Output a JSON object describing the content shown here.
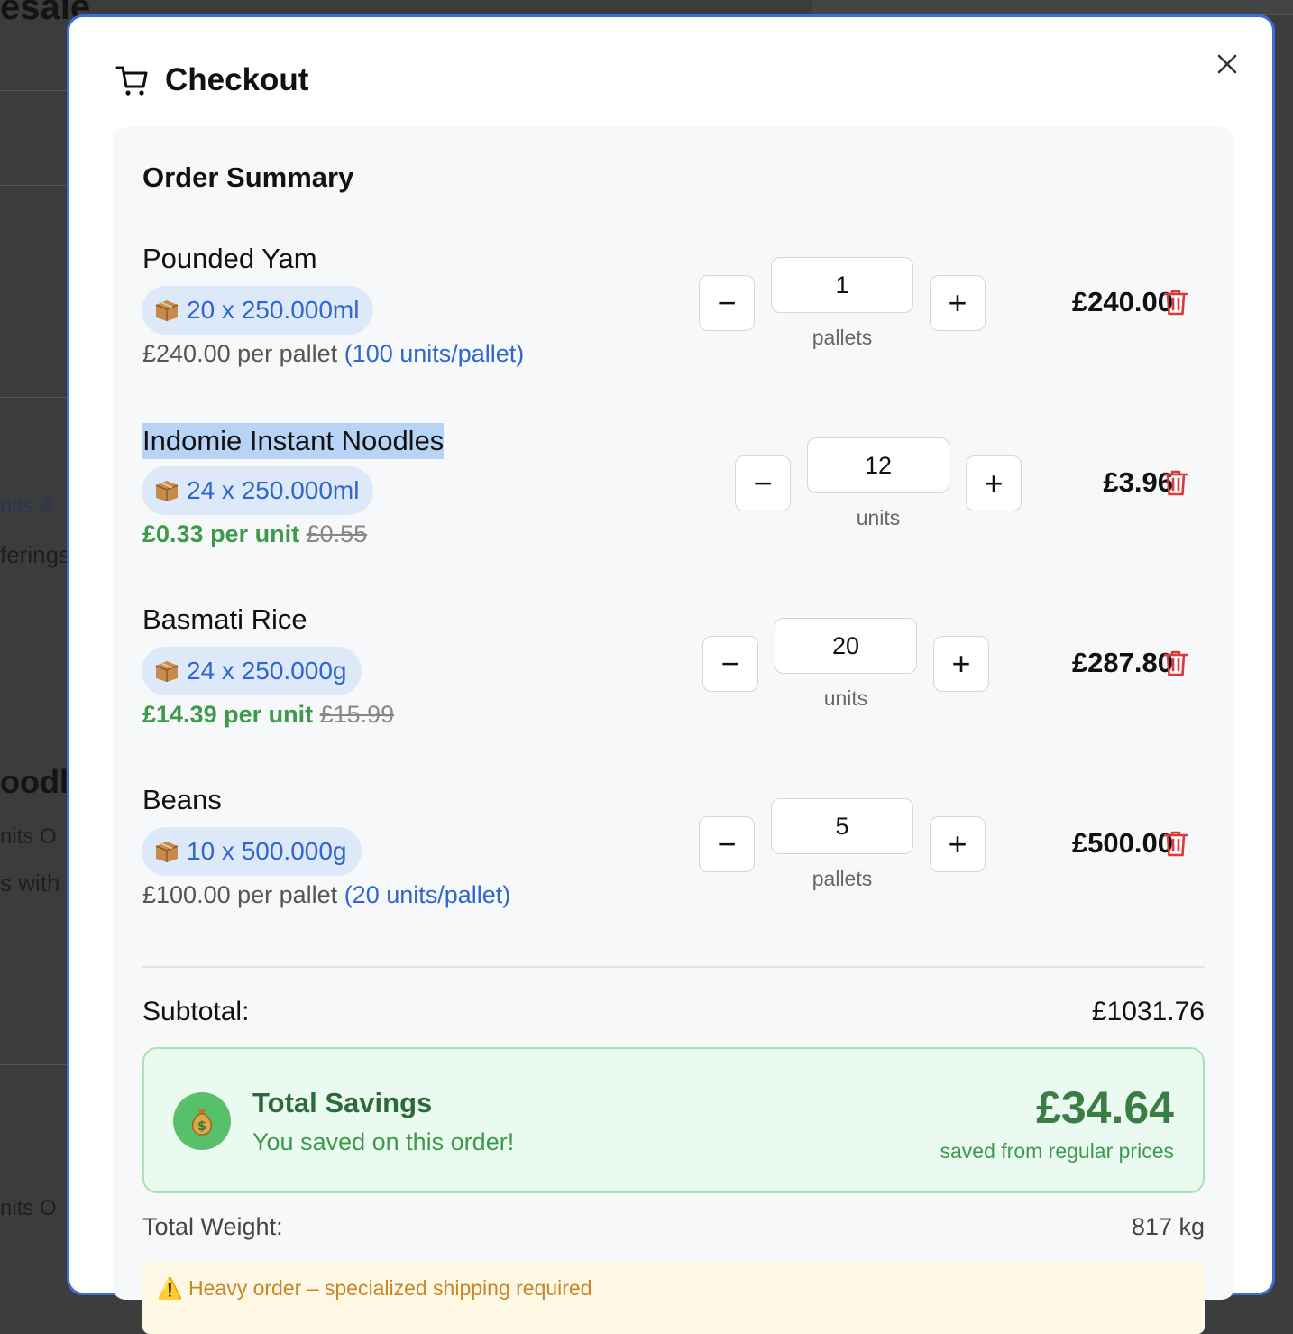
{
  "background": {
    "fragments": [
      "esale",
      "nits &",
      "ferings",
      "oodle",
      "nits O",
      "s with",
      "nits O"
    ]
  },
  "modal": {
    "title": "Checkout",
    "icons": {
      "cart": "cart-icon",
      "close": "close-icon"
    }
  },
  "summary": {
    "title": "Order Summary",
    "items": [
      {
        "name": "Pounded Yam",
        "pack": "20 x 250.000ml",
        "price_main": "£240.00 per pallet",
        "price_extra": "(100 units/pallet)",
        "quantity": "1",
        "unit": "pallets",
        "total": "£240.00"
      },
      {
        "name": "Indomie Instant Noodles",
        "pack": "24 x 250.000ml",
        "price_main": "£0.33 per unit",
        "price_extra": "£0.55",
        "quantity": "12",
        "unit": "units",
        "total": "£3.96"
      },
      {
        "name": "Basmati Rice",
        "pack": "24 x 250.000g",
        "price_main": "£14.39 per unit",
        "price_extra": "£15.99",
        "quantity": "20",
        "unit": "units",
        "total": "£287.80"
      },
      {
        "name": "Beans",
        "pack": "10 x 500.000g",
        "price_main": "£100.00 per pallet",
        "price_extra": "(20 units/pallet)",
        "quantity": "5",
        "unit": "pallets",
        "total": "£500.00"
      }
    ],
    "stepper": {
      "minus": "−",
      "plus": "+"
    },
    "subtotal_label": "Subtotal:",
    "subtotal_value": "£1031.76",
    "savings": {
      "title": "Total Savings",
      "subtitle": "You saved on this order!",
      "amount": "£34.64",
      "note": "saved from regular prices"
    },
    "weight_label": "Total Weight:",
    "weight_value": "817 kg",
    "warning": "⚠️ Heavy order – specialized shipping required"
  },
  "colors": {
    "accent_blue": "#2f66d0",
    "savings_green": "#3a7d45",
    "delete_red": "#d93a3a",
    "modal_border": "#3b6fd8"
  }
}
